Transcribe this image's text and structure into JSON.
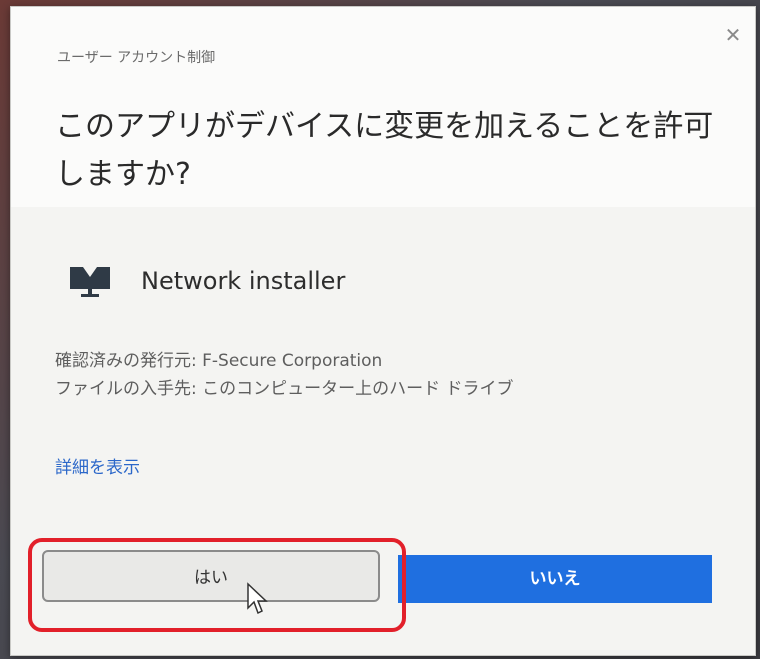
{
  "dialog": {
    "subtitle": "ユーザー アカウント制御",
    "question": "このアプリがデバイスに変更を加えることを許可しますか?",
    "close_icon": "close-icon",
    "app": {
      "name": "Network installer",
      "icon": "network-installer-icon"
    },
    "publisher_line": "確認済みの発行元: F-Secure Corporation",
    "origin_line": "ファイルの入手先: このコンピューター上のハード ドライブ",
    "details_link": "詳細を表示",
    "buttons": {
      "yes": "はい",
      "no": "いいえ"
    }
  },
  "colors": {
    "primary_button": "#1f6fe0",
    "highlight": "#e2202a",
    "link": "#2b67c9"
  }
}
